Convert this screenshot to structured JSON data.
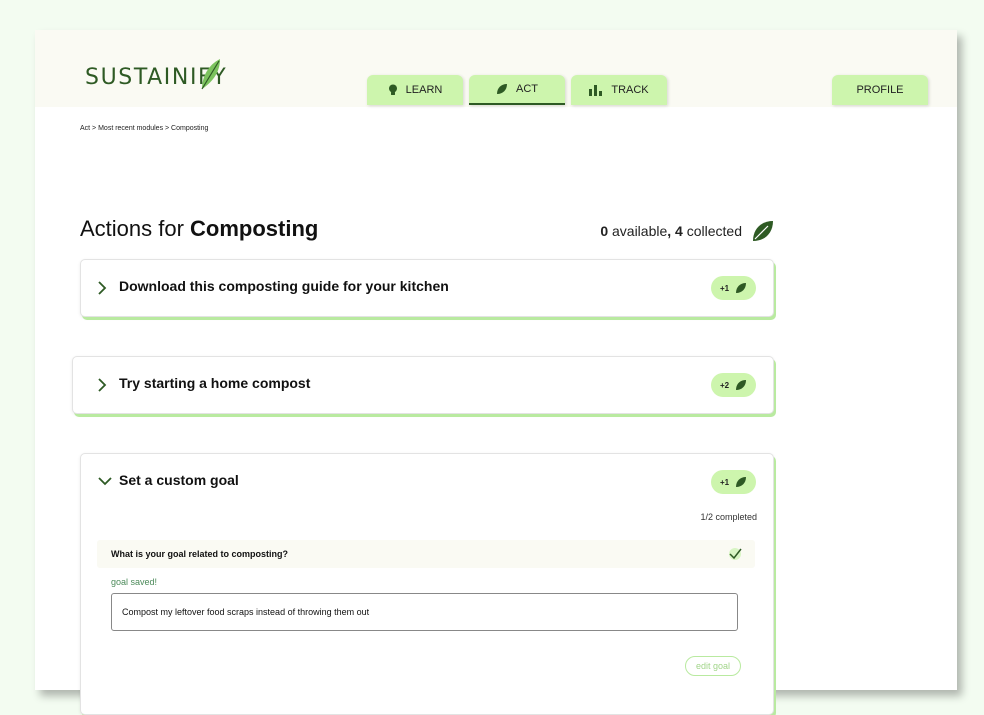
{
  "app": {
    "name": "SUSTAINIFY"
  },
  "nav": {
    "tabs": [
      {
        "label": "LEARN",
        "icon": "lightbulb-icon"
      },
      {
        "label": "ACT",
        "icon": "leaf-icon",
        "active": true
      },
      {
        "label": "TRACK",
        "icon": "bar-chart-icon"
      }
    ],
    "profile_label": "PROFILE"
  },
  "breadcrumb": "Act > Most recent modules > Composting",
  "page": {
    "title_prefix": "Actions for ",
    "title_topic": "Composting",
    "available_count": "0",
    "available_label": " available",
    "comma": ",",
    "collected_count": "4",
    "collected_label": " collected"
  },
  "actions": [
    {
      "title": "Download this composting guide for your kitchen",
      "points": "+1",
      "expanded": false
    },
    {
      "title": "Try starting a home compost",
      "points": "+2",
      "expanded": false
    },
    {
      "title": "Set a custom goal",
      "points": "+1",
      "expanded": true,
      "progress": "1/2 completed",
      "question": "What is your goal related to composting?",
      "saved_label": "goal saved!",
      "goal_value": "Compost my leftover food scraps instead of throwing them out",
      "edit_label": "edit goal"
    }
  ],
  "colors": {
    "brand_dark_green": "#2e5a24",
    "accent_light_green": "#cdf5ad",
    "page_background": "#f3fcf1",
    "header_background": "#fafaf3"
  }
}
